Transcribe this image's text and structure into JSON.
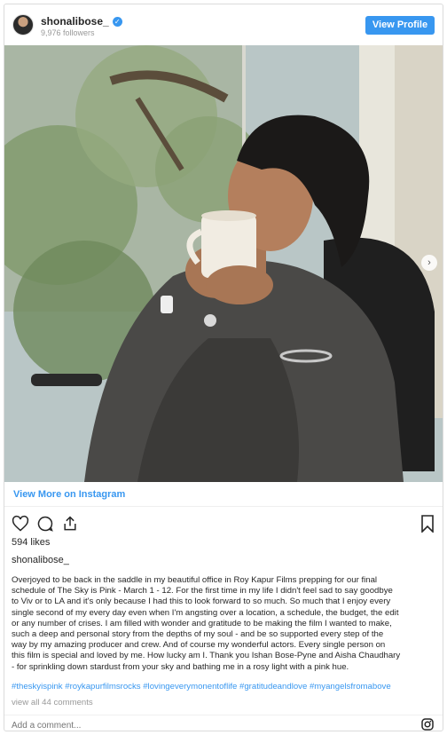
{
  "header": {
    "username": "shonalibose_",
    "followers": "9,976 followers",
    "view_profile_label": "View Profile"
  },
  "photo": {
    "description_icon": "photo-image"
  },
  "links": {
    "view_more": "View More on Instagram"
  },
  "engagement": {
    "likes": "594 likes",
    "post_username": "shonalibose_"
  },
  "caption": {
    "text": "Overjoyed to be back in the saddle in my beautiful office in Roy Kapur Films prepping for our final\nschedule of The Sky is Pink - March 1 - 12. For the first time in my life I didn't feel sad to say goodbye\nto Viv or to LA and it's only because I had this to look forward to so much. So much that I enjoy every\nsingle second of my every day even when I'm angsting over a location, a schedule, the budget, the edit\nor any number of crises. I am filled with wonder and gratitude to be making the film I wanted to make,\nsuch a deep and personal story from the depths of my soul - and be so supported every step of the\nway by my amazing producer and crew. And of course my wonderful actors. Every single person on\nthis film is special and loved by me. How lucky am I. Thank you Ishan Bose-Pyne and Aisha Chaudhary\n- for sprinkling down stardust from your sky and bathing me in a rosy light with a pink hue.",
    "hashtags": "#theskyispink #roykapurfilmsrocks #lovingeverymonentoflife #gratitudeandlove #myangelsfromabove",
    "view_comments": "view all 44 comments"
  },
  "comment": {
    "placeholder": "Add a comment..."
  },
  "colors": {
    "accent": "#3897f0",
    "text": "#262626",
    "muted": "#999999",
    "border": "#dbdbdb"
  }
}
